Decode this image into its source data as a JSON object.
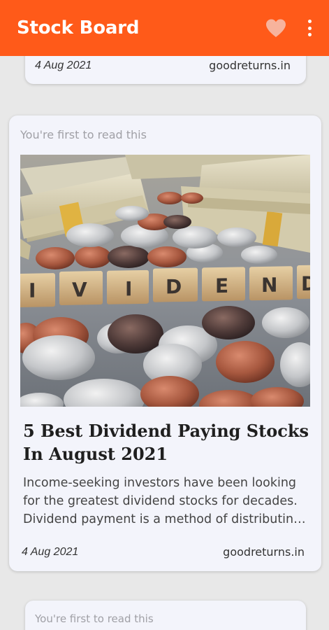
{
  "app": {
    "title": "Stock Board",
    "brand_color": "#ff5a19",
    "actions": {
      "favorite_icon": "heart-icon",
      "menu_icon": "more-vertical-icon"
    }
  },
  "feed": {
    "cards": [
      {
        "date": "4 Aug 2021",
        "source": "goodreturns.in"
      },
      {
        "badge": "You're first to read this",
        "image_icon": "dividend-coins-photo",
        "title": "5 Best Dividend Paying Stocks In August 2021",
        "summary": "Income-seeking investors have been looking for the greatest dividend stocks for decades. Dividend payment is a method of distributing profits to shareholders.",
        "date": "4 Aug 2021",
        "source": "goodreturns.in"
      },
      {
        "badge": "You're first to read this"
      }
    ]
  }
}
